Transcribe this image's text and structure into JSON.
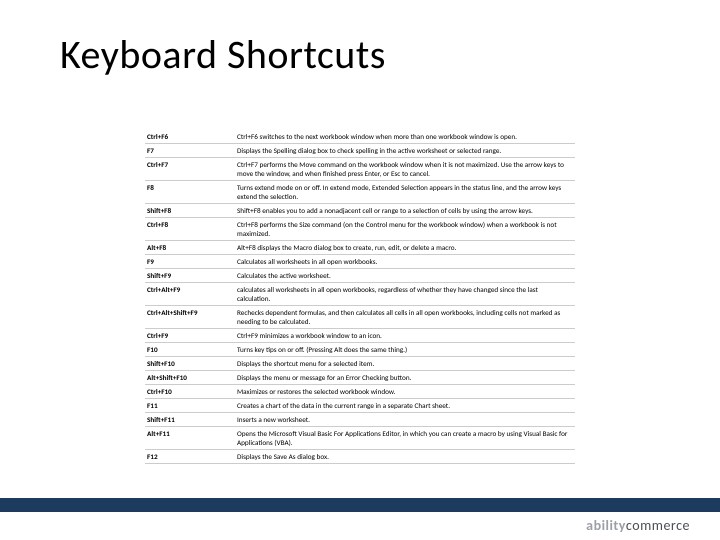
{
  "title": "Keyboard Shortcuts",
  "logo": {
    "left": "ability",
    "right": "commerce"
  },
  "rows": [
    {
      "key": "Ctrl+F6",
      "desc": "Ctrl+F6 switches to the next workbook window when more than one workbook window is open."
    },
    {
      "key": "F7",
      "desc": "Displays the Spelling dialog box to check spelling in the active worksheet or selected range."
    },
    {
      "key": "Ctrl+F7",
      "desc": "Ctrl+F7 performs the Move command on the workbook window when it is not maximized. Use the arrow keys to move the window, and when finished press Enter, or Esc to cancel."
    },
    {
      "key": "F8",
      "desc": "Turns extend mode on or off. In extend mode, Extended Selection appears in the status line, and the arrow keys extend the selection."
    },
    {
      "key": "Shift+F8",
      "desc": "Shift+F8 enables you to add a nonadjacent cell or range to a selection of cells by using the arrow keys."
    },
    {
      "key": "Ctrl+F8",
      "desc": "Ctrl+F8 performs the Size command (on the Control menu for the workbook window) when a workbook is not maximized."
    },
    {
      "key": "Alt+F8",
      "desc": "Alt+F8 displays the Macro dialog box to create, run, edit, or delete a macro."
    },
    {
      "key": "F9",
      "desc": "Calculates all worksheets in all open workbooks."
    },
    {
      "key": "Shift+F9",
      "desc": "Calculates the active worksheet."
    },
    {
      "key": "Ctrl+Alt+F9",
      "desc": "calculates all worksheets in all open workbooks, regardless of whether they have changed since the last calculation."
    },
    {
      "key": "Ctrl+Alt+Shift+F9",
      "desc": "Rechecks dependent formulas, and then calculates all cells in all open workbooks, including cells not marked as needing to be calculated."
    },
    {
      "key": "Ctrl+F9",
      "desc": "Ctrl+F9 minimizes a workbook window to an icon."
    },
    {
      "key": "F10",
      "desc": "Turns key tips on or off. (Pressing Alt does the same thing.)"
    },
    {
      "key": "Shift+F10",
      "desc": "Displays the shortcut menu for a selected item."
    },
    {
      "key": "Alt+Shift+F10",
      "desc": "Displays the menu or message for an Error Checking button."
    },
    {
      "key": "Ctrl+F10",
      "desc": "Maximizes or restores the selected workbook window."
    },
    {
      "key": "F11",
      "desc": "Creates a chart of the data in the current range in a separate Chart sheet."
    },
    {
      "key": "Shift+F11",
      "desc": "Inserts a new worksheet."
    },
    {
      "key": "Alt+F11",
      "desc": "Opens the Microsoft Visual Basic For Applications Editor, in which you can create a macro by using Visual Basic for Applications (VBA)."
    },
    {
      "key": "F12",
      "desc": "Displays the Save As dialog box."
    }
  ]
}
